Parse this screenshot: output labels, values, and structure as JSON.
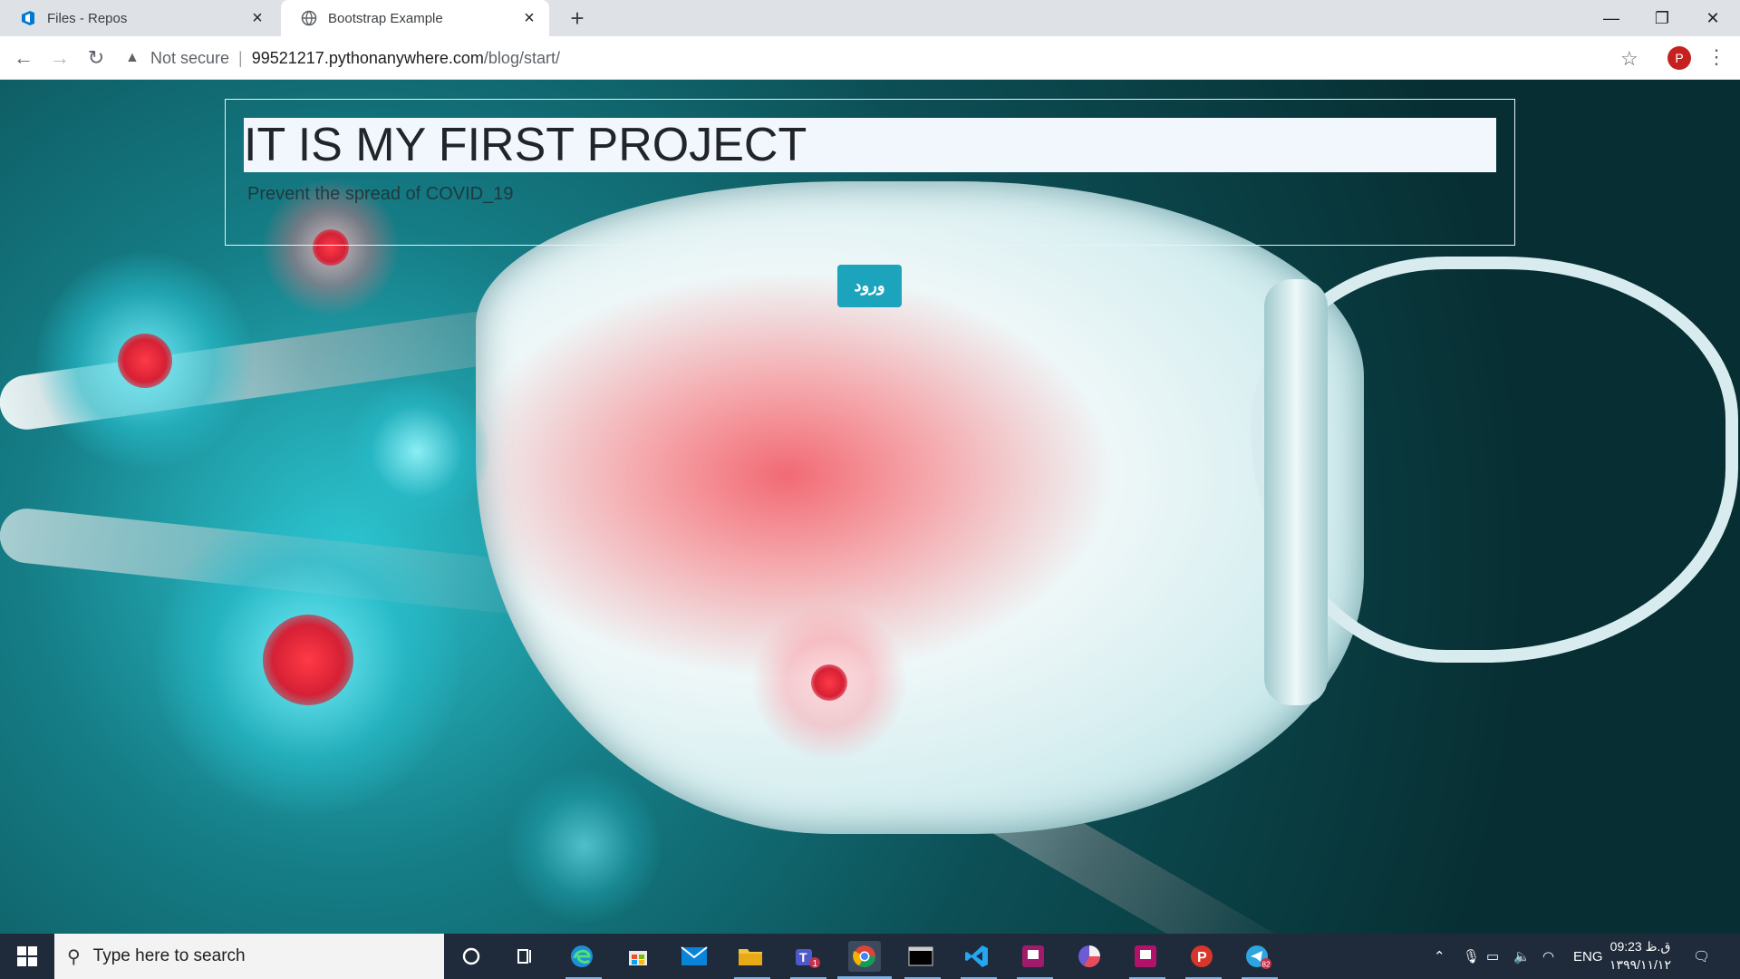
{
  "browser": {
    "tabs": [
      {
        "label": "Files - Repos",
        "active": false
      },
      {
        "label": "Bootstrap Example",
        "active": true
      }
    ],
    "address": {
      "security_label": "Not secure",
      "url_host": "99521217.pythonanywhere.com",
      "url_path": "/blog/start/"
    },
    "profile_initial": "P"
  },
  "page": {
    "title": "IT IS MY FIRST PROJECT",
    "subtitle": "Prevent the spread of COVID_19",
    "login_button": "ورود",
    "accent_color": "#1ba4bc"
  },
  "taskbar": {
    "search_placeholder": "Type here to search",
    "apps": [
      "cortana-icon",
      "task-view-icon",
      "edge-icon",
      "store-icon",
      "mail-icon",
      "file-explorer-icon",
      "teams-icon",
      "chrome-icon",
      "terminal-icon",
      "vscode-icon",
      "app-icon",
      "chart-app-icon",
      "app-icon-2",
      "p-app-icon",
      "telegram-icon"
    ],
    "teams_badge": "1",
    "telegram_badge": "82",
    "language": "ENG",
    "time": "09:23 ق.ظ",
    "date": "۱۳۹۹/۱۱/۱۲"
  }
}
